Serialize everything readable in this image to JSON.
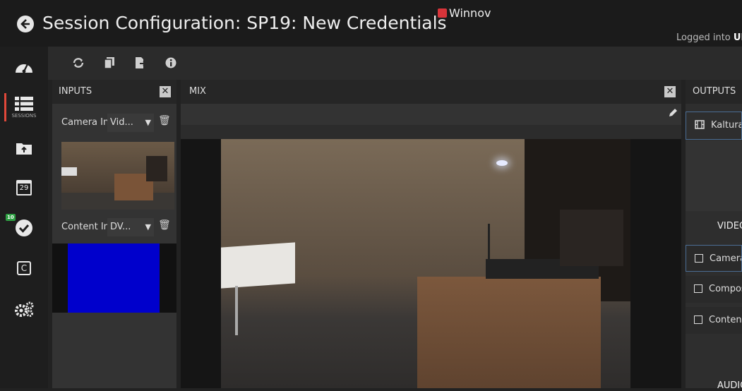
{
  "header": {
    "title": "Session Configuration: SP19: New Credentials",
    "brand": "Winnov",
    "login_prefix": "Logged into",
    "login_user": "UM"
  },
  "sidebar": {
    "items": [
      {
        "icon": "dashboard-icon"
      },
      {
        "icon": "sessions-icon",
        "label": "SESSIONS",
        "active": true
      },
      {
        "icon": "folder-upload-icon"
      },
      {
        "icon": "calendar-icon",
        "text": "29"
      },
      {
        "icon": "check-circle-icon",
        "badge": "10"
      },
      {
        "icon": "c-box-icon",
        "text": "C"
      },
      {
        "icon": "gears-icon"
      }
    ]
  },
  "toolbar": {
    "icons": [
      "refresh-icon",
      "copy-icon",
      "export-icon",
      "info-icon"
    ]
  },
  "inputs": {
    "title": "INPUTS",
    "items": [
      {
        "name": "Camera Input",
        "source": "Vid..."
      },
      {
        "name": "Content Input",
        "source": "DV..."
      }
    ]
  },
  "mix": {
    "title": "MIX"
  },
  "outputs": {
    "title": "OUTPUTS",
    "first_item": "Kaltura",
    "video_section": "VIDEO",
    "video_items": [
      "Camera",
      "Composite",
      "Content"
    ],
    "audio_section": "AUDIO"
  },
  "colors": {
    "accent": "#e0483a",
    "badge": "#2ea043",
    "blue_preview": "#0000cc"
  }
}
